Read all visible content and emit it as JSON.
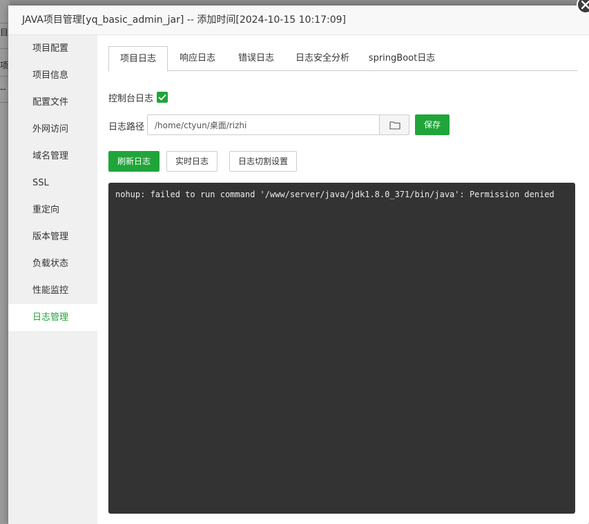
{
  "background": {
    "fragments": [
      "目",
      "项",
      "--"
    ]
  },
  "dialog": {
    "title": "JAVA项目管理[yq_basic_admin_jar] -- 添加时间[2024-10-15 10:17:09]",
    "close_icon": "close-icon"
  },
  "sidebar": {
    "items": [
      {
        "label": "项目配置"
      },
      {
        "label": "项目信息"
      },
      {
        "label": "配置文件"
      },
      {
        "label": "外网访问"
      },
      {
        "label": "域名管理"
      },
      {
        "label": "SSL"
      },
      {
        "label": "重定向"
      },
      {
        "label": "版本管理"
      },
      {
        "label": "负载状态"
      },
      {
        "label": "性能监控"
      },
      {
        "label": "日志管理"
      }
    ],
    "active_index": 10
  },
  "tabs": [
    {
      "label": "项目日志"
    },
    {
      "label": "响应日志"
    },
    {
      "label": "错误日志"
    },
    {
      "label": "日志安全分析"
    },
    {
      "label": "springBoot日志"
    }
  ],
  "console_log": {
    "label": "控制台日志",
    "checked": true
  },
  "log_path": {
    "label": "日志路径",
    "value": "/home/ctyun/桌面/rizhi",
    "save_label": "保存"
  },
  "actions": {
    "refresh": "刷新日志",
    "realtime": "实时日志",
    "split": "日志切割设置"
  },
  "log_output": "nohup: failed to run command '/www/server/java/jdk1.8.0_371/bin/java': Permission denied",
  "colors": {
    "accent": "#20a53a",
    "log_bg": "#333333"
  }
}
